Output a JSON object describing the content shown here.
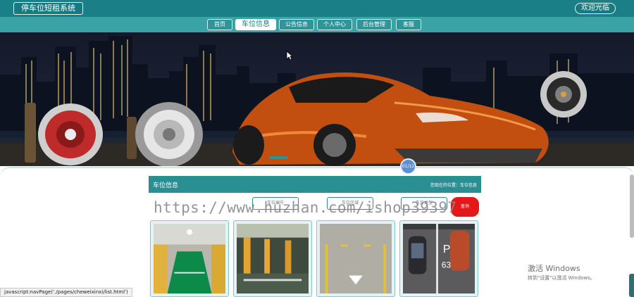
{
  "header": {
    "system_title": "停车位短租系统",
    "welcome": "欢迎光临"
  },
  "nav": {
    "items": [
      {
        "label": "首页",
        "active": false
      },
      {
        "label": "车位信息",
        "active": true
      },
      {
        "label": "公告信息",
        "active": false
      },
      {
        "label": "个人中心",
        "active": false
      },
      {
        "label": "后台管理",
        "active": false
      },
      {
        "label": "客服",
        "active": false
      }
    ]
  },
  "banner": {
    "page_indicator": "01/12"
  },
  "section": {
    "title": "车位信息",
    "breadcrumb": "您现在的位置：车位信息"
  },
  "filters": {
    "buttons": [
      "车位编号",
      "车位区域",
      "车位类型"
    ],
    "search": "查询"
  },
  "watermark": "https://www.huzhan.com/ishop39397",
  "status_bar": "javascript:navPage('./pages/cheweixinxi/list.html')",
  "activation": {
    "title": "激活 Windows",
    "subtitle": "转到\"设置\"以激活 Windows。"
  },
  "colors": {
    "primary": "#1a7f86",
    "nav": "#3aa3a6",
    "search_button": "#e41818"
  }
}
